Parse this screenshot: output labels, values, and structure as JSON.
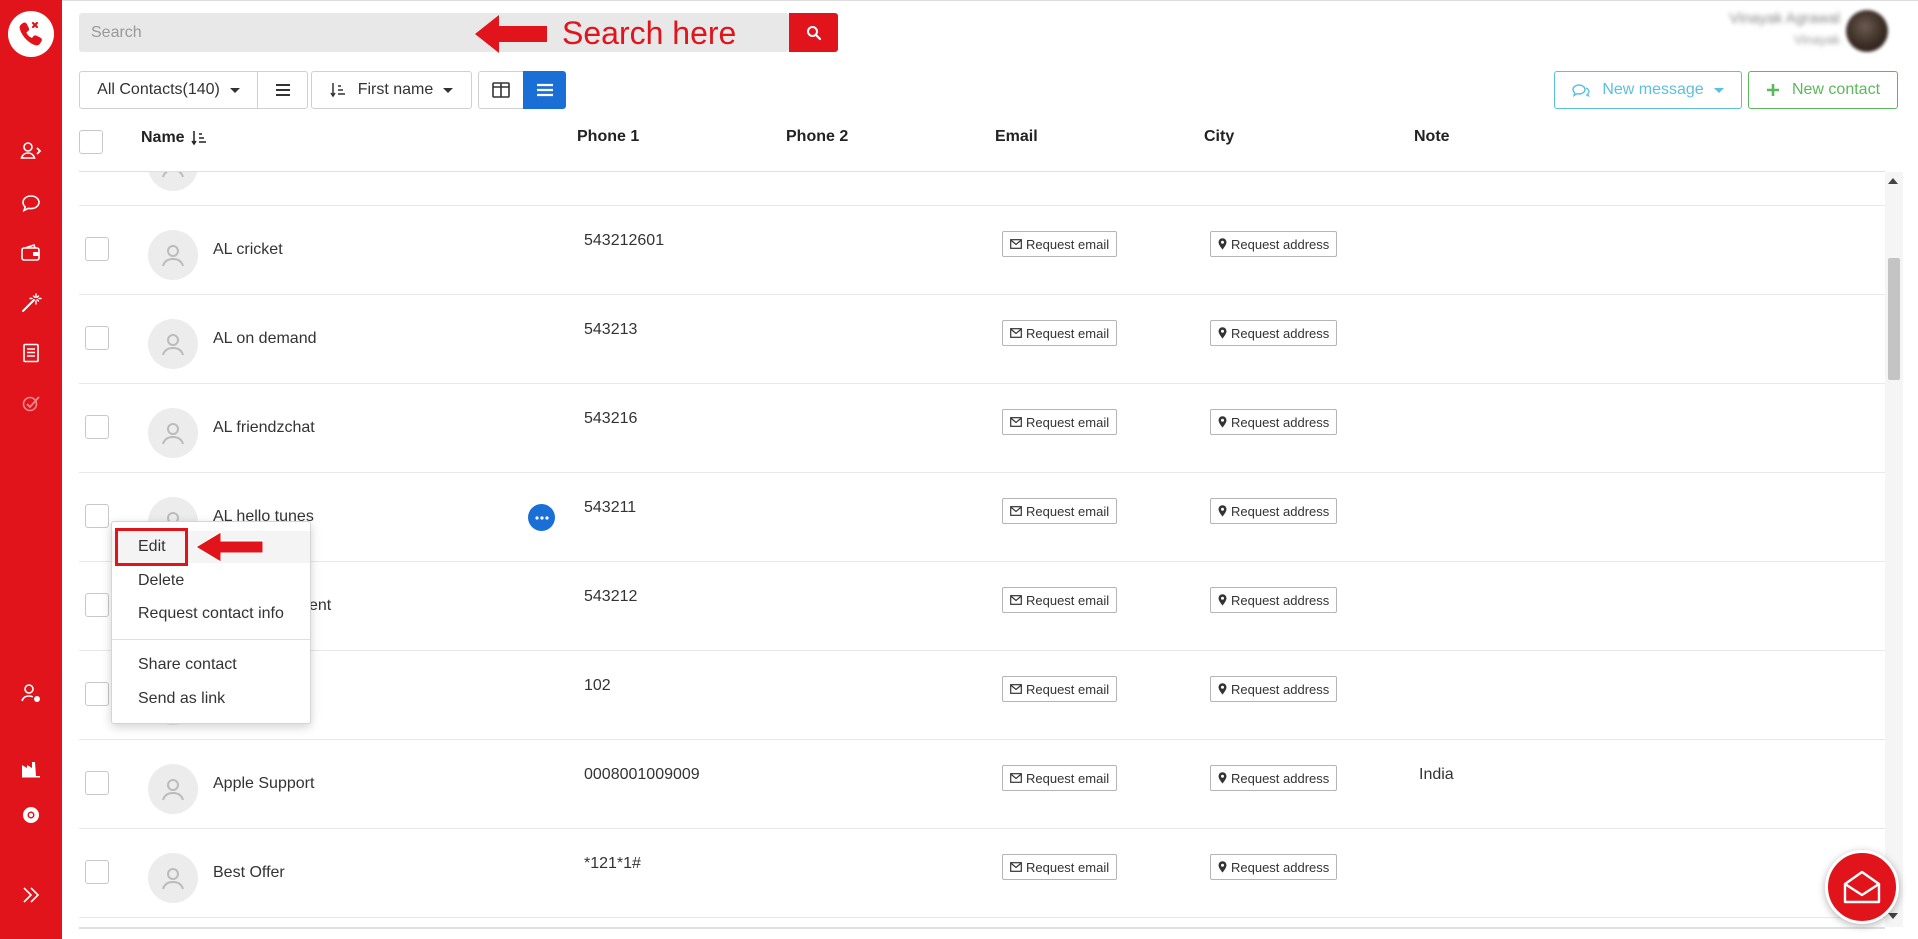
{
  "search": {
    "placeholder": "Search",
    "annotation": "Search here"
  },
  "user": {
    "name": "Vinayak Agrawal",
    "subtitle": "Vinayak"
  },
  "toolbar": {
    "filter_label": "All Contacts(140)",
    "sort_label": "First name",
    "new_message_label": "New message",
    "new_contact_label": "New contact"
  },
  "columns": {
    "name": "Name",
    "phone1": "Phone 1",
    "phone2": "Phone 2",
    "email": "Email",
    "city": "City",
    "note": "Note"
  },
  "rows": [
    {
      "name": "AL cricket",
      "phone1": "543212601",
      "email_btn": "Request email",
      "address_btn": "Request address",
      "note": ""
    },
    {
      "name": "AL on demand",
      "phone1": "543213",
      "email_btn": "Request email",
      "address_btn": "Request address",
      "note": ""
    },
    {
      "name": "AL friendzchat",
      "phone1": "543216",
      "email_btn": "Request email",
      "address_btn": "Request address",
      "note": ""
    },
    {
      "name": "AL hello tunes",
      "phone1": "543211",
      "email_btn": "Request email",
      "address_btn": "Request address",
      "note": ""
    },
    {
      "name": "ent",
      "phone1": "543212",
      "email_btn": "Request email",
      "address_btn": "Request address",
      "note": ""
    },
    {
      "name": "",
      "phone1": "102",
      "email_btn": "Request email",
      "address_btn": "Request address",
      "note": ""
    },
    {
      "name": "Apple Support",
      "phone1": "0008001009009",
      "email_btn": "Request email",
      "address_btn": "Request address",
      "note": "India"
    },
    {
      "name": "Best Offer",
      "phone1": "*121*1#",
      "email_btn": "Request email",
      "address_btn": "Request address",
      "note": ""
    }
  ],
  "context_menu": {
    "edit": "Edit",
    "delete": "Delete",
    "request_info": "Request contact info",
    "share": "Share contact",
    "send_link": "Send as link"
  },
  "colors": {
    "brand_red": "#e1141c",
    "blue": "#1a6fd6",
    "info": "#5bc0de",
    "success": "#5cb85c"
  },
  "icons": [
    "phone-logo-icon",
    "contacts-icon",
    "chat-icon",
    "wallet-icon",
    "magic-wand-icon",
    "document-icon",
    "check-icon",
    "user-settings-icon",
    "factory-icon",
    "chrome-icon",
    "double-chevron-right-icon",
    "search-icon",
    "list-icon",
    "sort-icon",
    "split-view-icon",
    "table-view-icon",
    "comment-icon",
    "plus-icon",
    "user-avatar-icon",
    "envelope-icon",
    "map-marker-icon",
    "ellipsis-icon",
    "envelope-open-icon"
  ]
}
